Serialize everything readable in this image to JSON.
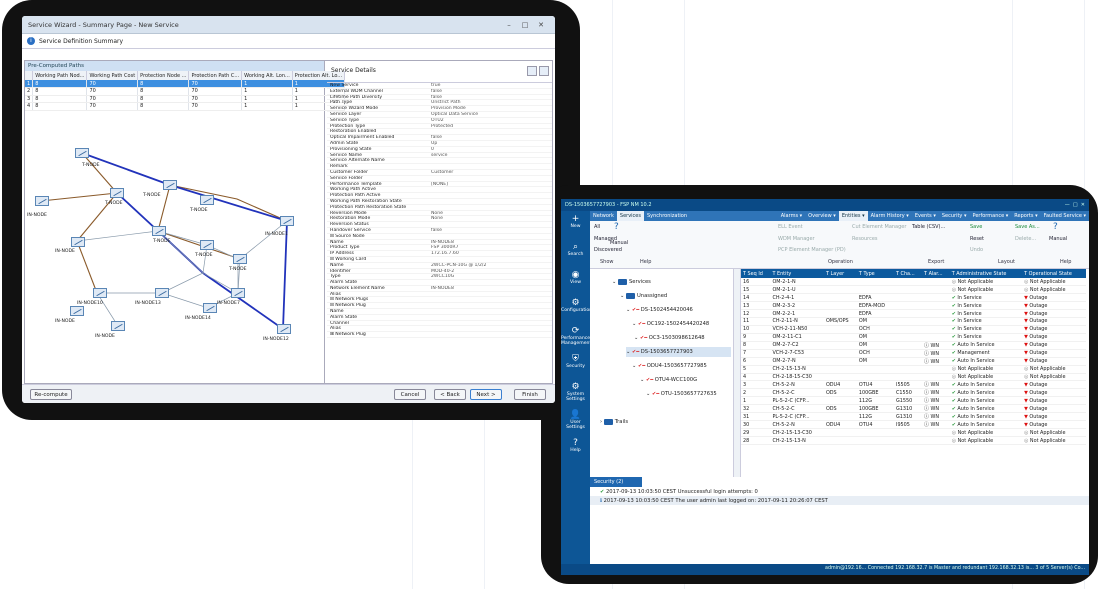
{
  "wizard": {
    "title": "Service Wizard - Summary Page - New Service",
    "subtitle": "Service Definition Summary",
    "pcp_title": "Pre-Computed Paths",
    "columns": [
      "Working Path Nod...",
      "Working Path Cost",
      "Protection Node ...",
      "Protection Path C...",
      "Working Alt. Lon...",
      "Protection Alt. Lo..."
    ],
    "rows": [
      [
        "1",
        "8",
        "70",
        "8",
        "70",
        "1",
        "1"
      ],
      [
        "2",
        "8",
        "70",
        "8",
        "70",
        "1",
        "1"
      ],
      [
        "3",
        "8",
        "70",
        "8",
        "70",
        "1",
        "1"
      ],
      [
        "4",
        "8",
        "70",
        "8",
        "70",
        "1",
        "1"
      ]
    ],
    "nodes": [
      "T-NODE",
      "T-NODE",
      "T-NODE",
      "IN-NODE",
      "IN-NODE",
      "T-NODE",
      "T-NODE",
      "T-NODE",
      "T-NODE",
      "IN-NODE1",
      "IN-NODE10",
      "IN-NODE",
      "IN-NODE",
      "IN-NODE13",
      "IN-NODE12",
      "IN-NODE14",
      "IN-NODE7"
    ],
    "details_title": "Service Details",
    "details": [
      [
        "New Service",
        "true"
      ],
      [
        "External WDM Channel",
        "false"
      ],
      [
        "Lifetime Path Diversity",
        "false"
      ],
      [
        "Path Type",
        "Unstrict Path"
      ],
      [
        "Service Wizard Mode",
        "Provision Mode"
      ],
      [
        "Service Layer",
        "Optical Data Service"
      ],
      [
        "Service Type",
        "OTU2"
      ],
      [
        "Protection Type",
        "Protected"
      ],
      [
        "Restoration Enabled",
        ""
      ],
      [
        "Optical Impairment Enabled",
        "false"
      ],
      [
        "Admin State",
        "Up"
      ],
      [
        "Provisioning State",
        "0"
      ],
      [
        "Service Name",
        "service"
      ],
      [
        "Service Alternate Name",
        ""
      ],
      [
        "Remark",
        ""
      ],
      [
        "Customer Folder",
        "Customer"
      ],
      [
        "Service Folder",
        ""
      ],
      [
        "Performance Template",
        "[NONE]"
      ],
      [
        "Working Path Active",
        ""
      ],
      [
        "Protection Path Active",
        ""
      ],
      [
        "Working Path Restoration State",
        ""
      ],
      [
        "Protection Path Restoration State",
        ""
      ],
      [
        "Reversion Mode",
        "None"
      ],
      [
        "Restoration Mode",
        "None"
      ],
      [
        "Reversion Status",
        ""
      ],
      [
        "Handover Service",
        "false"
      ],
      [
        "⊟ Source Node",
        ""
      ],
      [
        "    Name",
        "IN-NODE8"
      ],
      [
        "    Product Type",
        "FSP 3000R7"
      ],
      [
        "    IP Address",
        "172.16.7.60"
      ],
      [
        "  ⊟ Working Card",
        ""
      ],
      [
        "      Name",
        "2WCC-PCN-10G @ 1/2/2"
      ],
      [
        "      Identifier",
        "MOD-40-2"
      ],
      [
        "      Type",
        "2WCC10G"
      ],
      [
        "      Alarm State",
        ""
      ],
      [
        "      Network Element Name",
        "IN-NODE8"
      ],
      [
        "      Alias",
        ""
      ],
      [
        "    ⊟ Network Plugs",
        ""
      ],
      [
        "      ⊟ Network Plug",
        ""
      ],
      [
        "          Name",
        ""
      ],
      [
        "          Alarm State",
        ""
      ],
      [
        "          Channel",
        ""
      ],
      [
        "          Alias",
        ""
      ],
      [
        "      ⊞ Network Plug",
        ""
      ]
    ],
    "buttons": {
      "recompute": "Re-compute",
      "cancel": "Cancel",
      "back": "< Back",
      "next": "Next >",
      "finish": "Finish"
    }
  },
  "app": {
    "title": "DS-1503657727903 - FSP NM 10.2",
    "sidebar": [
      [
        "+",
        "New"
      ],
      [
        "⌕",
        "Search"
      ],
      [
        "◉",
        "View"
      ],
      [
        "⚙",
        "Configuration"
      ],
      [
        "⟳",
        "Performance Management"
      ],
      [
        "⛨",
        "Security"
      ],
      [
        "⚙",
        "System Settings"
      ],
      [
        "👤",
        "User Settings"
      ],
      [
        "?",
        "Help"
      ]
    ],
    "left_tabs": [
      "Network",
      "Services",
      "Synchronization"
    ],
    "right_tabs": [
      "Alarms",
      "Overview",
      "Entities",
      "Alarm History",
      "Events",
      "Security",
      "Performance",
      "Reports",
      "Faulted Service"
    ],
    "show": {
      "all": "All",
      "managed": "Managed",
      "discovered": "Discovered",
      "manual": "Manual",
      "show": "Show",
      "help": "Help"
    },
    "ribbon": {
      "ell": "ELL Event",
      "wdm": "WDM Manager",
      "pcp": "PCP Element Manager (PD)",
      "cuem": "Cut Element Manager",
      "res": "Resources",
      "table": "Table (CSV)...",
      "save": "Save",
      "reset": "Reset",
      "undo": "Undo",
      "saveas": "Save As...",
      "delete": "Delete...",
      "manual": "Manual",
      "operation": "Operation",
      "export": "Export",
      "layout": "Layout",
      "help": "Help"
    },
    "tree": [
      "Services",
      "Unassigned",
      "DS-1502454420046",
      "OC192-1502454420248",
      "OC3-1503098612648",
      "DS-1503657727903",
      "ODU4-1503657727985",
      "OTU4-WCC100G",
      "OTU-1503657727635",
      "Trails"
    ],
    "columns": [
      "Seq Id",
      "Entity",
      "Layer",
      "Type",
      "Cha...",
      "Alar...",
      "Administrative State",
      "Operational State"
    ],
    "rows": [
      [
        "16",
        "OM-2-1-N",
        "",
        "",
        "",
        "",
        "Not Applicable",
        "Not Applicable"
      ],
      [
        "15",
        "OM-2-1-U",
        "",
        "",
        "",
        "",
        "Not Applicable",
        "Not Applicable"
      ],
      [
        "14",
        "CH-2-4-1",
        "",
        "EDFA",
        "",
        "",
        "In Service",
        "Outage"
      ],
      [
        "13",
        "OM-2-3-2",
        "",
        "EDFA-MOD",
        "",
        "",
        "In Service",
        "Outage"
      ],
      [
        "12",
        "OM-2-2-1",
        "",
        "EDFA",
        "",
        "",
        "In Service",
        "Outage"
      ],
      [
        "11",
        "CH-2-11-N",
        "OMS/OPS",
        "OM",
        "",
        "",
        "In Service",
        "Outage"
      ],
      [
        "10",
        "VCH-2-11-N50",
        "",
        "OCH",
        "",
        "",
        "In Service",
        "Outage"
      ],
      [
        "9",
        "OM-2-11-C1",
        "",
        "OM",
        "",
        "",
        "In Service",
        "Outage"
      ],
      [
        "8",
        "OM-2-7-C2",
        "",
        "OM",
        "",
        "WN",
        "Auto In Service",
        "Outage"
      ],
      [
        "7",
        "VCH-2-7-C53",
        "",
        "OCH",
        "",
        "WN",
        "Management",
        "Outage"
      ],
      [
        "6",
        "OM-2-7-N",
        "",
        "OM",
        "",
        "WN",
        "Auto In Service",
        "Outage"
      ],
      [
        "5",
        "CH-2-15-13-N",
        "",
        "",
        "",
        "",
        "Not Applicable",
        "Not Applicable"
      ],
      [
        "4",
        "CH-2-18-15-C30",
        "",
        "",
        "",
        "",
        "Not Applicable",
        "Not Applicable"
      ],
      [
        "3",
        "CH-5-2-N",
        "ODU4",
        "OTU4",
        "I5505",
        "WN",
        "Auto In Service",
        "Outage"
      ],
      [
        "2",
        "CH-5-2-C",
        "ODS",
        "100GBE",
        "C1550",
        "WN",
        "Auto In Service",
        "Outage"
      ],
      [
        "1",
        "PL-5-2-C (CFP...",
        "",
        "112G",
        "G1550",
        "WN",
        "Auto In Service",
        "Outage"
      ],
      [
        "32",
        "CH-5-2-C",
        "ODS",
        "100GBE",
        "G1310",
        "WN",
        "Auto In Service",
        "Outage"
      ],
      [
        "31",
        "PL-5-2-C (CFP...",
        "",
        "112G",
        "G1310",
        "WN",
        "Auto In Service",
        "Outage"
      ],
      [
        "30",
        "CH-5-2-N",
        "ODU4",
        "OTU4",
        "I9505",
        "WN",
        "Auto In Service",
        "Outage"
      ],
      [
        "29",
        "CH-2-15-13-C30",
        "",
        "",
        "",
        "",
        "Not Applicable",
        "Not Applicable"
      ],
      [
        "28",
        "CH-2-15-13-N",
        "",
        "",
        "",
        "",
        "Not Applicable",
        "Not Applicable"
      ]
    ],
    "security_tab": "Security (2)",
    "security": [
      "2017-09-13 10:03:50 CEST   Unsuccessful login attempts: 0",
      "2017-09-13 10:03:50 CEST   The user admin last logged on: 2017-09-11 20:26:07 CEST"
    ],
    "status": "admin@192.16...   Connected 192.168.32.7 is Master and redundant 192.168.32.13 is...   3 of 5 Server(s) Co..."
  }
}
